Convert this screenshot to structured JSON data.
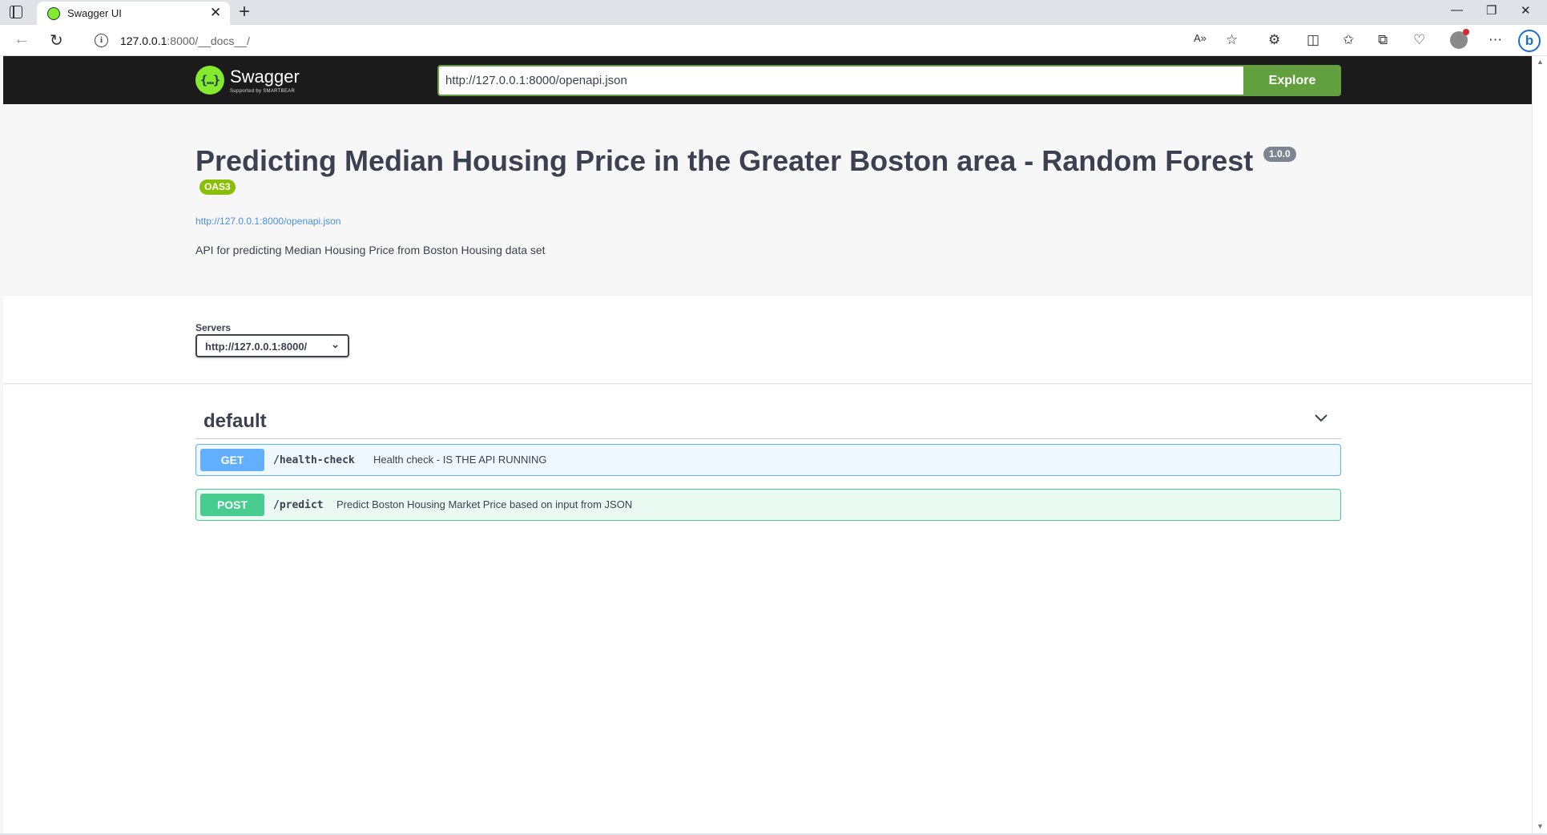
{
  "browser": {
    "tab_title": "Swagger UI",
    "url_host": "127.0.0.1",
    "url_rest": ":8000/__docs__/"
  },
  "swagger": {
    "logo_name": "Swagger",
    "logo_sub": "Supported by SMARTBEAR",
    "spec_url_value": "http://127.0.0.1:8000/openapi.json",
    "explore_label": "Explore"
  },
  "info": {
    "title": "Predicting Median Housing Price in the Greater Boston area - Random Forest",
    "version": "1.0.0",
    "oas_badge": "OAS3",
    "spec_link": "http://127.0.0.1:8000/openapi.json",
    "description": "API for predicting Median Housing Price from Boston Housing data set"
  },
  "servers": {
    "label": "Servers",
    "selected": "http://127.0.0.1:8000/"
  },
  "tag": {
    "name": "default"
  },
  "operations": [
    {
      "method": "GET",
      "path": "/health-check",
      "summary": "Health check - IS THE API RUNNING"
    },
    {
      "method": "POST",
      "path": "/predict",
      "summary": "Predict Boston Housing Market Price based on input from JSON"
    }
  ],
  "colors": {
    "get": "#61affe",
    "post": "#49cc90",
    "explore": "#62a03f",
    "topbar": "#1b1b1b",
    "oas": "#89bf04"
  }
}
